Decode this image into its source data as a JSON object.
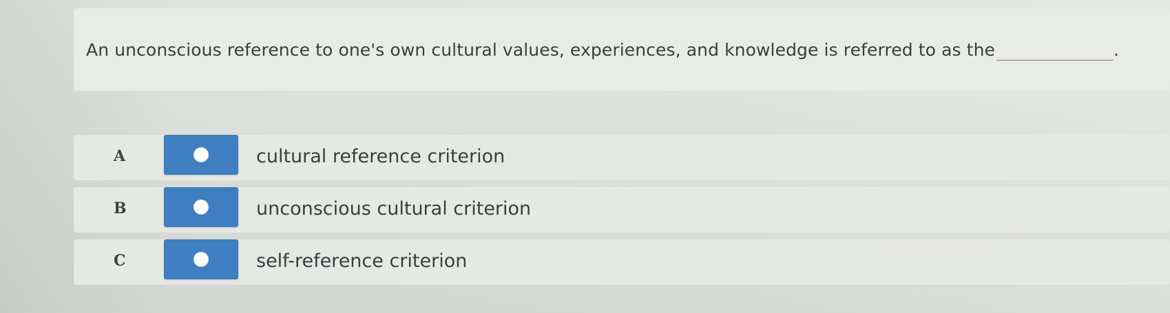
{
  "question": {
    "text": "An unconscious reference to one's own cultural values, experiences, and knowledge is referred to as the",
    "trailing": "."
  },
  "options": [
    {
      "letter": "A",
      "label": "cultural reference criterion",
      "selected": false
    },
    {
      "letter": "B",
      "label": "unconscious cultural criterion",
      "selected": false
    },
    {
      "letter": "C",
      "label": "self-reference criterion",
      "selected": false
    }
  ],
  "colors": {
    "radio_button": "#3f7ec0",
    "text": "#3b3e40",
    "background": "#dcdfdb"
  }
}
